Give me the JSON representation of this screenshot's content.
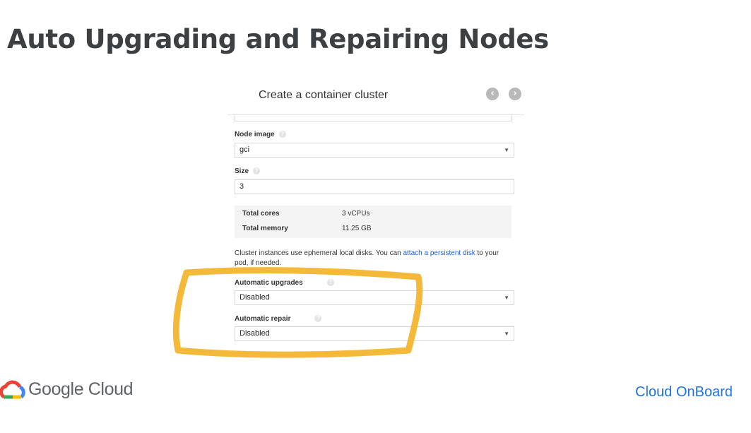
{
  "slide": {
    "title": "Auto Upgrading and Repairing Nodes"
  },
  "dialog": {
    "title": "Create a container cluster",
    "nav_prev": "‹",
    "nav_next": "›",
    "node_image": {
      "label": "Node image",
      "value": "gci"
    },
    "size": {
      "label": "Size",
      "value": "3"
    },
    "summary": [
      {
        "key": "Total cores",
        "value": "3 vCPUs"
      },
      {
        "key": "Total memory",
        "value": "11.25 GB"
      }
    ],
    "note": {
      "text_before": "Cluster instances use ephemeral local disks. You can ",
      "link": "attach a persistent disk",
      "text_after": " to your pod, if needed."
    },
    "auto_upgrades": {
      "label": "Automatic upgrades",
      "value": "Disabled"
    },
    "auto_repair": {
      "label": "Automatic repair",
      "value": "Disabled"
    }
  },
  "footer": {
    "brand": "Google Cloud",
    "right_text": "Cloud OnBoard"
  },
  "colors": {
    "highlight": "#f5b93a",
    "link": "#1a5fd0",
    "brand_blue": "#1a73e8",
    "logo_red": "#ea4335",
    "logo_yellow": "#fbbc04",
    "logo_green": "#34a853",
    "logo_blue": "#4285f4"
  },
  "icons": [
    "help-icon",
    "dropdown-arrow-icon",
    "chevron-left-icon",
    "chevron-right-icon",
    "google-cloud-logo-icon"
  ]
}
